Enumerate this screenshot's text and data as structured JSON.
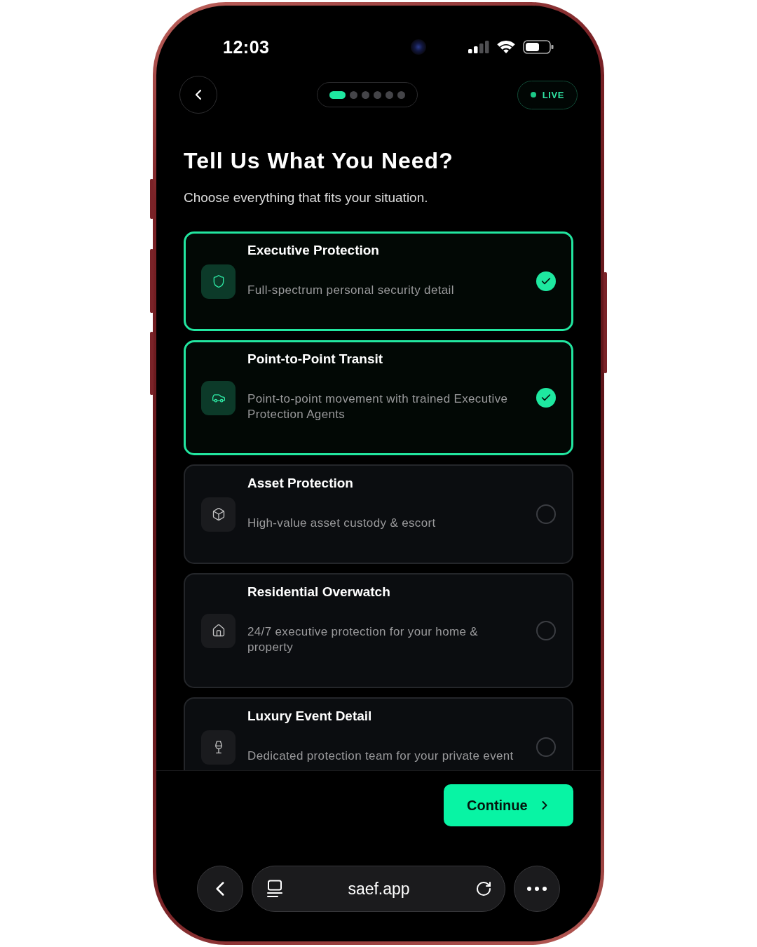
{
  "status_bar": {
    "time": "12:03"
  },
  "nav": {
    "steps": [
      {
        "selected": true
      },
      {
        "selected": false
      },
      {
        "selected": false
      },
      {
        "selected": false
      },
      {
        "selected": false
      },
      {
        "selected": false
      }
    ],
    "live_badge": {
      "label": "LIVE"
    }
  },
  "heading": {
    "title": "Tell Us What You Need?",
    "subtitle": "Choose everything that fits your situation."
  },
  "options": [
    {
      "title": "Executive Protection",
      "description": "Full-spectrum personal security detail",
      "selected": true
    },
    {
      "title": "Point-to-Point Transit",
      "description": "Point-to-point movement with trained Executive Protection Agents",
      "selected": true
    },
    {
      "title": "Asset Protection",
      "description": "High-value asset custody & escort",
      "selected": false
    },
    {
      "title": "Residential Overwatch",
      "description": "24/7 executive protection for your home & property",
      "selected": false
    },
    {
      "title": "Luxury Event Detail",
      "description": "Dedicated protection team for your private event",
      "selected": false
    }
  ],
  "footer": {
    "button": "Continue"
  },
  "browser_bar": {
    "url": "saef.app"
  }
}
